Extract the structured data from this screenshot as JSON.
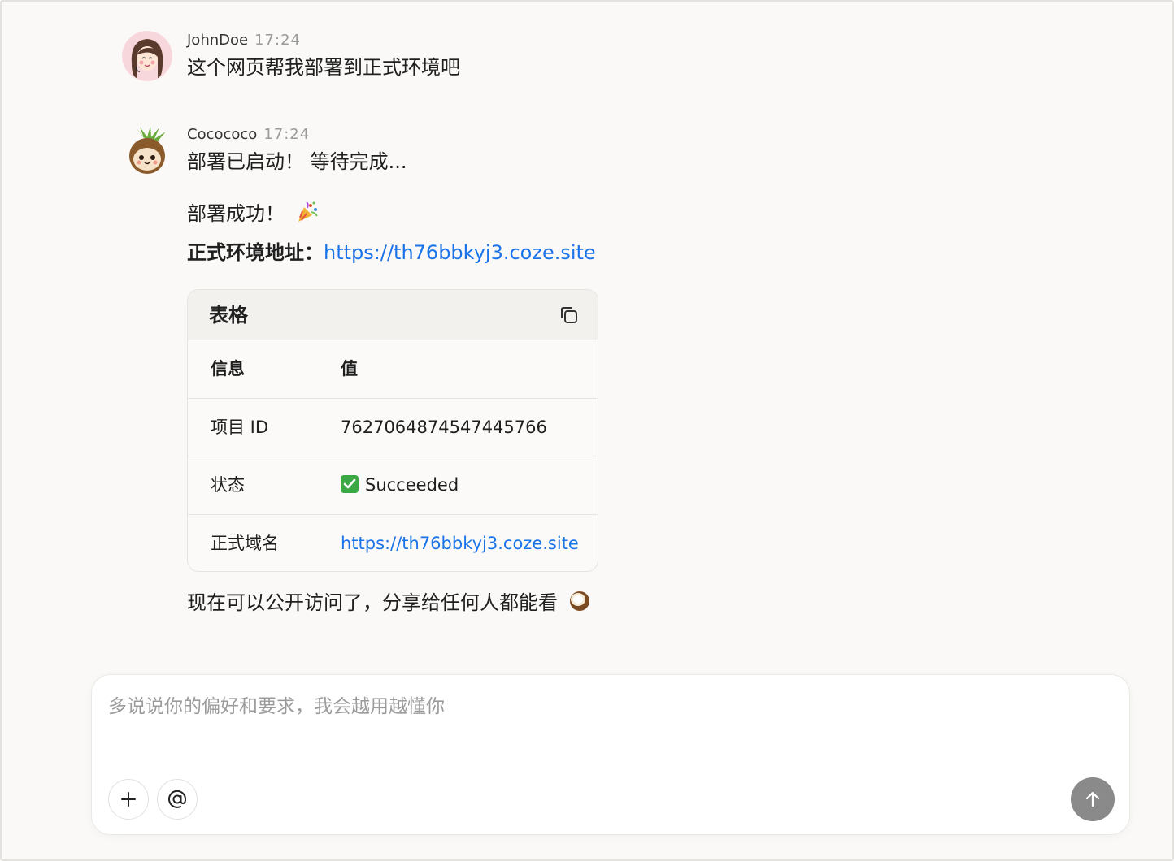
{
  "messages": {
    "user": {
      "name": "JohnDoe",
      "time": "17:24",
      "text": "这个网页帮我部署到正式环境吧"
    },
    "bot": {
      "name": "Cocococo",
      "time": "17:24",
      "line1": "部署已启动！ 等待完成...",
      "line2": "部署成功！",
      "address_label": "正式环境地址：",
      "address_url": "https://th76bbkyj3.coze.site",
      "closing": "现在可以公开访问了，分享给任何人都能看"
    }
  },
  "table": {
    "title": "表格",
    "headers": [
      "信息",
      "值"
    ],
    "rows": [
      [
        "项目 ID",
        "7627064874547445766"
      ],
      [
        "状态",
        "Succeeded"
      ],
      [
        "正式域名",
        "https://th76bbkyj3.coze.site"
      ]
    ]
  },
  "composer": {
    "placeholder": "多说说你的偏好和要求，我会越用越懂你"
  },
  "icons": {
    "copy": "copy-icon",
    "plus": "plus-icon",
    "at": "at-icon",
    "send": "arrow-up-icon",
    "party": "party-popper-icon",
    "coconut": "coconut-icon",
    "check": "check-mark-icon"
  },
  "colors": {
    "link": "#1a73e8",
    "check": "#3aa845",
    "send_button": "#8a8a8a",
    "background": "#faf9f7"
  }
}
